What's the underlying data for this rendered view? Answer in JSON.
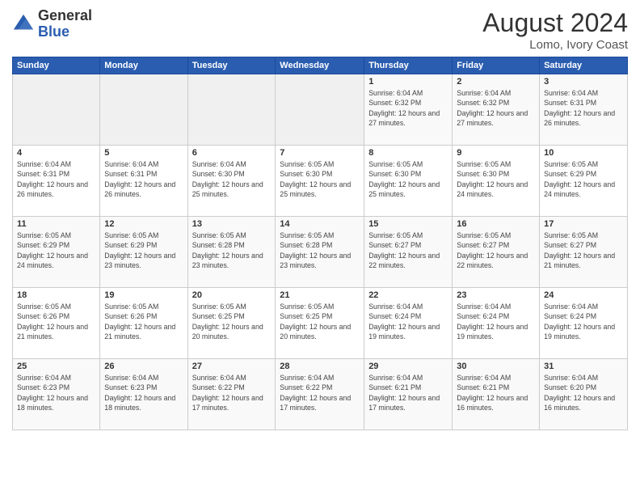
{
  "header": {
    "logo_general": "General",
    "logo_blue": "Blue",
    "month_year": "August 2024",
    "location": "Lomo, Ivory Coast"
  },
  "days_of_week": [
    "Sunday",
    "Monday",
    "Tuesday",
    "Wednesday",
    "Thursday",
    "Friday",
    "Saturday"
  ],
  "weeks": [
    [
      {
        "day": "",
        "detail": ""
      },
      {
        "day": "",
        "detail": ""
      },
      {
        "day": "",
        "detail": ""
      },
      {
        "day": "",
        "detail": ""
      },
      {
        "day": "1",
        "detail": "Sunrise: 6:04 AM\nSunset: 6:32 PM\nDaylight: 12 hours\nand 27 minutes."
      },
      {
        "day": "2",
        "detail": "Sunrise: 6:04 AM\nSunset: 6:32 PM\nDaylight: 12 hours\nand 27 minutes."
      },
      {
        "day": "3",
        "detail": "Sunrise: 6:04 AM\nSunset: 6:31 PM\nDaylight: 12 hours\nand 26 minutes."
      }
    ],
    [
      {
        "day": "4",
        "detail": "Sunrise: 6:04 AM\nSunset: 6:31 PM\nDaylight: 12 hours\nand 26 minutes."
      },
      {
        "day": "5",
        "detail": "Sunrise: 6:04 AM\nSunset: 6:31 PM\nDaylight: 12 hours\nand 26 minutes."
      },
      {
        "day": "6",
        "detail": "Sunrise: 6:04 AM\nSunset: 6:30 PM\nDaylight: 12 hours\nand 25 minutes."
      },
      {
        "day": "7",
        "detail": "Sunrise: 6:05 AM\nSunset: 6:30 PM\nDaylight: 12 hours\nand 25 minutes."
      },
      {
        "day": "8",
        "detail": "Sunrise: 6:05 AM\nSunset: 6:30 PM\nDaylight: 12 hours\nand 25 minutes."
      },
      {
        "day": "9",
        "detail": "Sunrise: 6:05 AM\nSunset: 6:30 PM\nDaylight: 12 hours\nand 24 minutes."
      },
      {
        "day": "10",
        "detail": "Sunrise: 6:05 AM\nSunset: 6:29 PM\nDaylight: 12 hours\nand 24 minutes."
      }
    ],
    [
      {
        "day": "11",
        "detail": "Sunrise: 6:05 AM\nSunset: 6:29 PM\nDaylight: 12 hours\nand 24 minutes."
      },
      {
        "day": "12",
        "detail": "Sunrise: 6:05 AM\nSunset: 6:29 PM\nDaylight: 12 hours\nand 23 minutes."
      },
      {
        "day": "13",
        "detail": "Sunrise: 6:05 AM\nSunset: 6:28 PM\nDaylight: 12 hours\nand 23 minutes."
      },
      {
        "day": "14",
        "detail": "Sunrise: 6:05 AM\nSunset: 6:28 PM\nDaylight: 12 hours\nand 23 minutes."
      },
      {
        "day": "15",
        "detail": "Sunrise: 6:05 AM\nSunset: 6:27 PM\nDaylight: 12 hours\nand 22 minutes."
      },
      {
        "day": "16",
        "detail": "Sunrise: 6:05 AM\nSunset: 6:27 PM\nDaylight: 12 hours\nand 22 minutes."
      },
      {
        "day": "17",
        "detail": "Sunrise: 6:05 AM\nSunset: 6:27 PM\nDaylight: 12 hours\nand 21 minutes."
      }
    ],
    [
      {
        "day": "18",
        "detail": "Sunrise: 6:05 AM\nSunset: 6:26 PM\nDaylight: 12 hours\nand 21 minutes."
      },
      {
        "day": "19",
        "detail": "Sunrise: 6:05 AM\nSunset: 6:26 PM\nDaylight: 12 hours\nand 21 minutes."
      },
      {
        "day": "20",
        "detail": "Sunrise: 6:05 AM\nSunset: 6:25 PM\nDaylight: 12 hours\nand 20 minutes."
      },
      {
        "day": "21",
        "detail": "Sunrise: 6:05 AM\nSunset: 6:25 PM\nDaylight: 12 hours\nand 20 minutes."
      },
      {
        "day": "22",
        "detail": "Sunrise: 6:04 AM\nSunset: 6:24 PM\nDaylight: 12 hours\nand 19 minutes."
      },
      {
        "day": "23",
        "detail": "Sunrise: 6:04 AM\nSunset: 6:24 PM\nDaylight: 12 hours\nand 19 minutes."
      },
      {
        "day": "24",
        "detail": "Sunrise: 6:04 AM\nSunset: 6:24 PM\nDaylight: 12 hours\nand 19 minutes."
      }
    ],
    [
      {
        "day": "25",
        "detail": "Sunrise: 6:04 AM\nSunset: 6:23 PM\nDaylight: 12 hours\nand 18 minutes."
      },
      {
        "day": "26",
        "detail": "Sunrise: 6:04 AM\nSunset: 6:23 PM\nDaylight: 12 hours\nand 18 minutes."
      },
      {
        "day": "27",
        "detail": "Sunrise: 6:04 AM\nSunset: 6:22 PM\nDaylight: 12 hours\nand 17 minutes."
      },
      {
        "day": "28",
        "detail": "Sunrise: 6:04 AM\nSunset: 6:22 PM\nDaylight: 12 hours\nand 17 minutes."
      },
      {
        "day": "29",
        "detail": "Sunrise: 6:04 AM\nSunset: 6:21 PM\nDaylight: 12 hours\nand 17 minutes."
      },
      {
        "day": "30",
        "detail": "Sunrise: 6:04 AM\nSunset: 6:21 PM\nDaylight: 12 hours\nand 16 minutes."
      },
      {
        "day": "31",
        "detail": "Sunrise: 6:04 AM\nSunset: 6:20 PM\nDaylight: 12 hours\nand 16 minutes."
      }
    ]
  ]
}
